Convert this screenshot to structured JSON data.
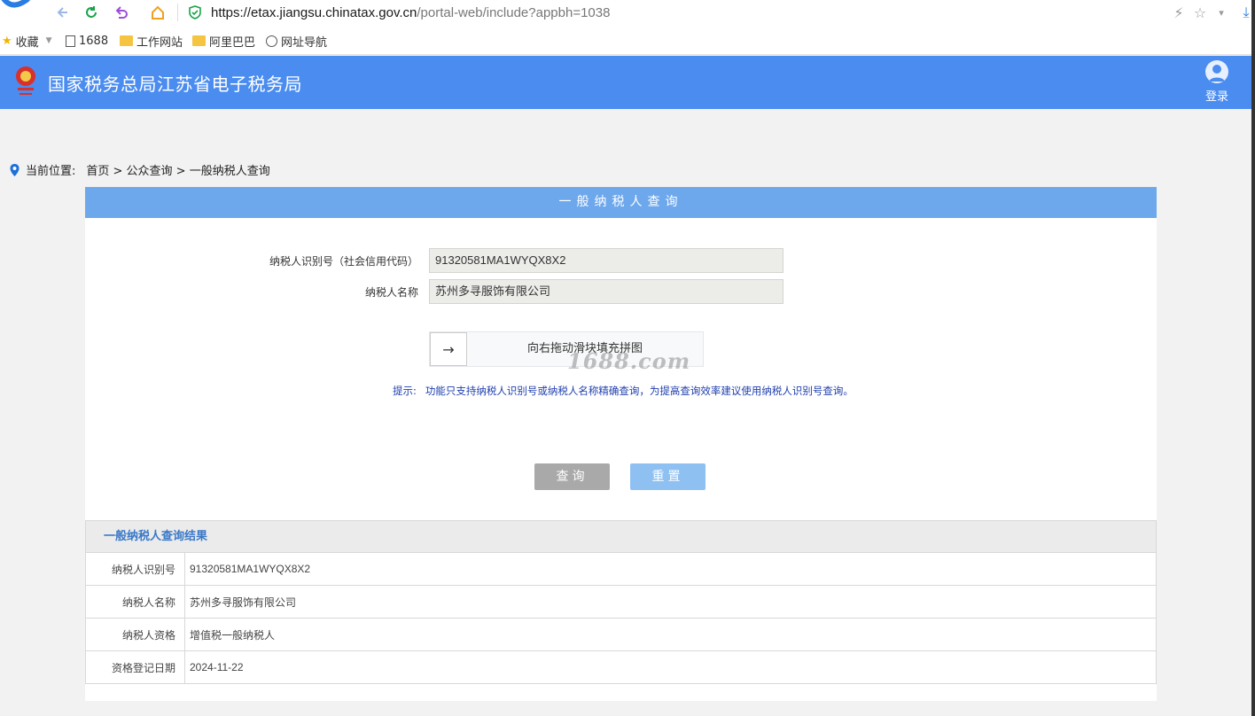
{
  "browser": {
    "url_host": "https://etax.jiangsu.chinatax.gov.cn",
    "url_path": "/portal-web/include?appbh=1038",
    "bookmarks": [
      "收藏",
      "1688",
      "工作网站",
      "阿里巴巴",
      "网址导航"
    ]
  },
  "header": {
    "site_title": "国家税务总局江苏省电子税务局",
    "login_label": "登录"
  },
  "breadcrumb": {
    "label": "当前位置:",
    "path": "首页 > 公众查询 > 一般纳税人查询"
  },
  "panel": {
    "title": "一般纳税人查询",
    "fields": [
      {
        "label": "纳税人识别号（社会信用代码）",
        "value": "91320581MA1WYQX8X2"
      },
      {
        "label": "纳税人名称",
        "value": "苏州多寻服饰有限公司"
      }
    ],
    "slider_text": "向右拖动滑块填充拼图",
    "watermark": "1688.com",
    "tip_label": "提示:",
    "tip_text": "功能只支持纳税人识别号或纳税人名称精确查询，为提高查询效率建议使用纳税人识别号查询。",
    "query_button": "查询",
    "reset_button": "重置"
  },
  "result": {
    "title": "一般纳税人查询结果",
    "rows": [
      {
        "key": "纳税人识别号",
        "value": "91320581MA1WYQX8X2"
      },
      {
        "key": "纳税人名称",
        "value": "苏州多寻服饰有限公司"
      },
      {
        "key": "纳税人资格",
        "value": "增值税一般纳税人"
      },
      {
        "key": "资格登记日期",
        "value": "2024-11-22"
      }
    ]
  },
  "colors": {
    "header_bg": "#4a8cf0",
    "panel_title_bg": "#6ea8ec",
    "tip_text": "#1f3fae",
    "result_title": "#3a78c8"
  }
}
